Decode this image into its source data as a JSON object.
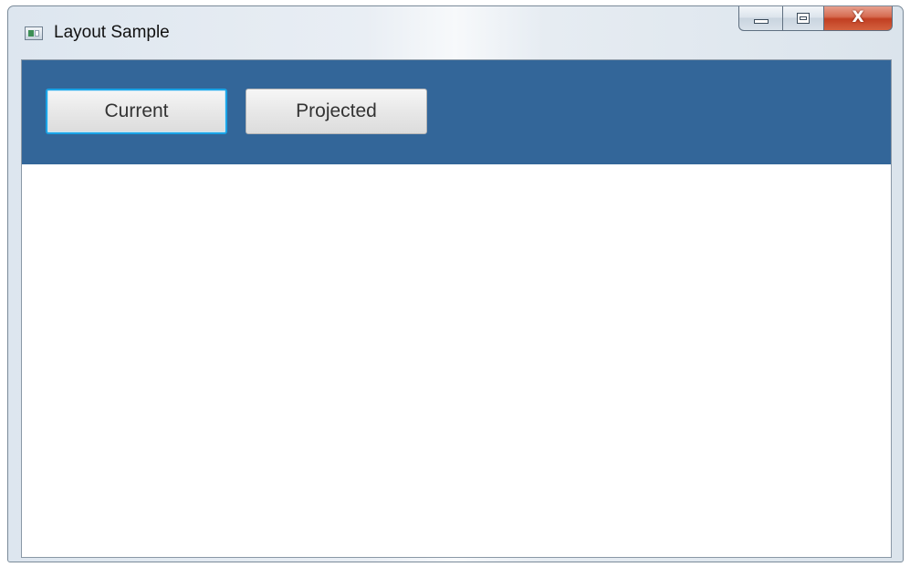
{
  "window": {
    "title": "Layout Sample",
    "close_glyph": "X"
  },
  "toolbar": {
    "background_color": "#336699",
    "buttons": [
      {
        "label": "Current",
        "focused": true
      },
      {
        "label": "Projected",
        "focused": false
      }
    ]
  },
  "icons": {
    "app": "window-app-icon",
    "minimize": "minimize-icon",
    "maximize": "maximize-icon",
    "close": "close-icon"
  }
}
